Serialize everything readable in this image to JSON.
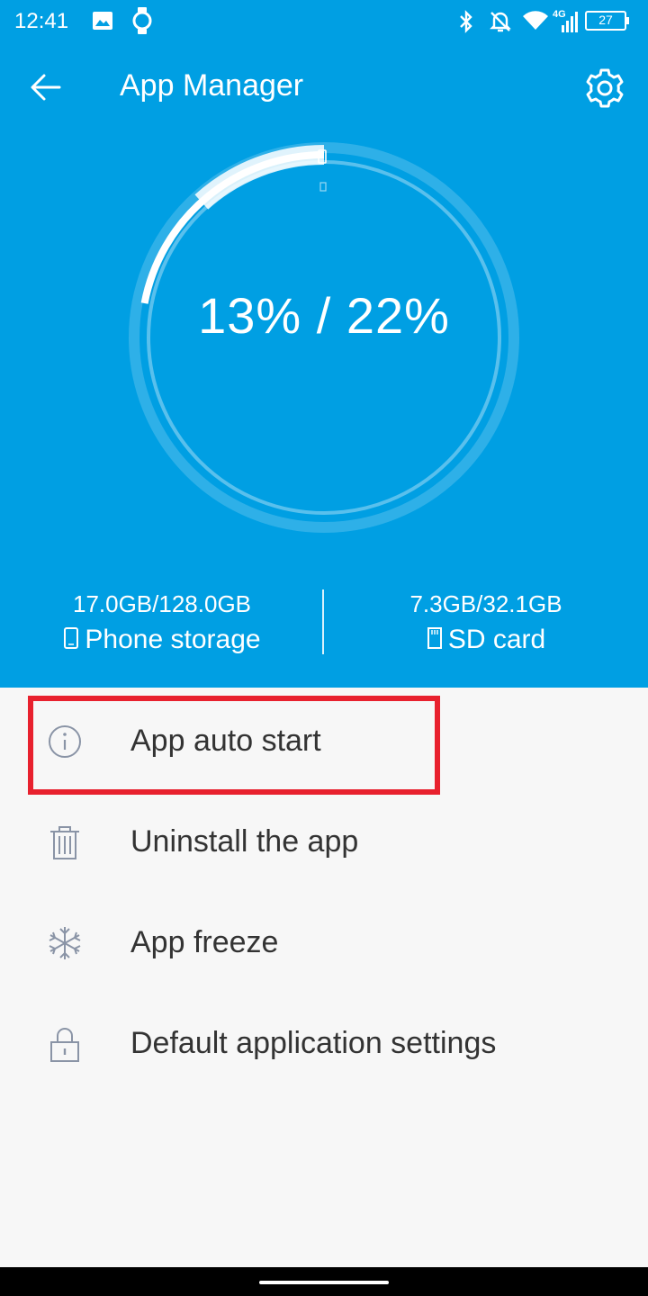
{
  "status_bar": {
    "time": "12:41",
    "battery_level": "27",
    "network_label": "4G",
    "icons": [
      "gallery-icon",
      "watch-icon",
      "bluetooth-icon",
      "mute-icon",
      "wifi-icon",
      "signal-icon",
      "battery-icon"
    ]
  },
  "toolbar": {
    "title": "App Manager",
    "back_icon": "back-arrow-icon",
    "settings_icon": "gear-icon"
  },
  "storage": {
    "center_text": "13% / 22%",
    "phone_used_fraction": 0.13,
    "sd_used_fraction": 0.22,
    "phone": {
      "value": "17.0GB/128.0GB",
      "label": "Phone storage",
      "icon": "phone-icon"
    },
    "sd": {
      "value": "7.3GB/32.1GB",
      "label": "SD card",
      "icon": "sd-card-icon"
    }
  },
  "menu": {
    "items": [
      {
        "label": "App auto start",
        "icon": "info-icon"
      },
      {
        "label": "Uninstall the app",
        "icon": "trash-icon"
      },
      {
        "label": "App freeze",
        "icon": "snowflake-icon"
      },
      {
        "label": "Default application settings",
        "icon": "lock-icon"
      }
    ]
  },
  "colors": {
    "header_bg": "#009fe3",
    "highlight": "#e8212e",
    "icon_gray": "#8a94a6",
    "text": "#333333"
  }
}
